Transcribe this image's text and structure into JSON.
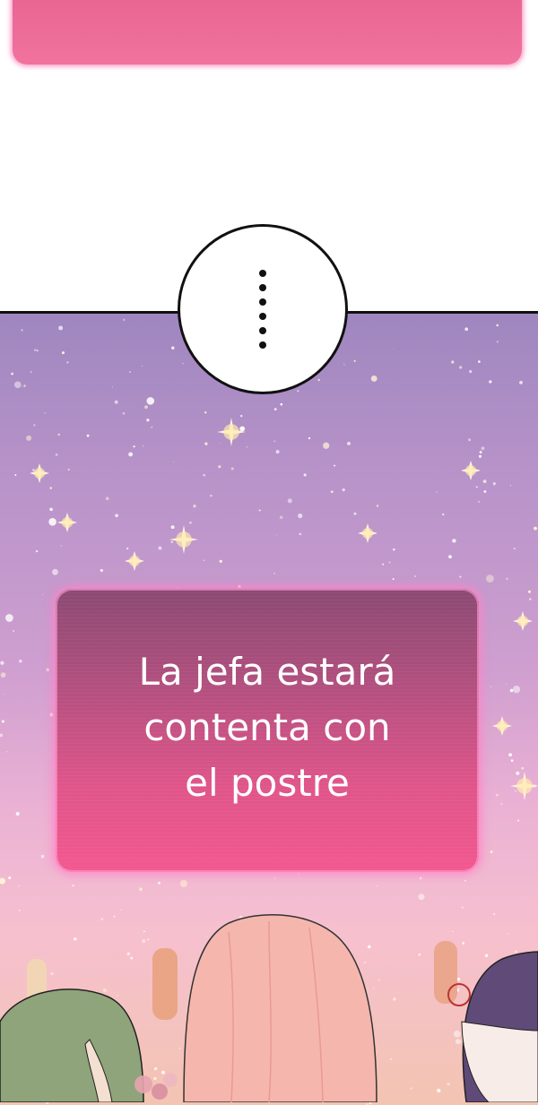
{
  "top_box": {
    "color": "#ee6b98"
  },
  "bubble": {
    "text": "......"
  },
  "caption": {
    "text": "La jefa estará\ncontenta con\nel postre"
  },
  "colors": {
    "sky_top": "#9f86bf",
    "sky_bottom": "#f3c4b2",
    "caption_box": "#e0558a"
  }
}
